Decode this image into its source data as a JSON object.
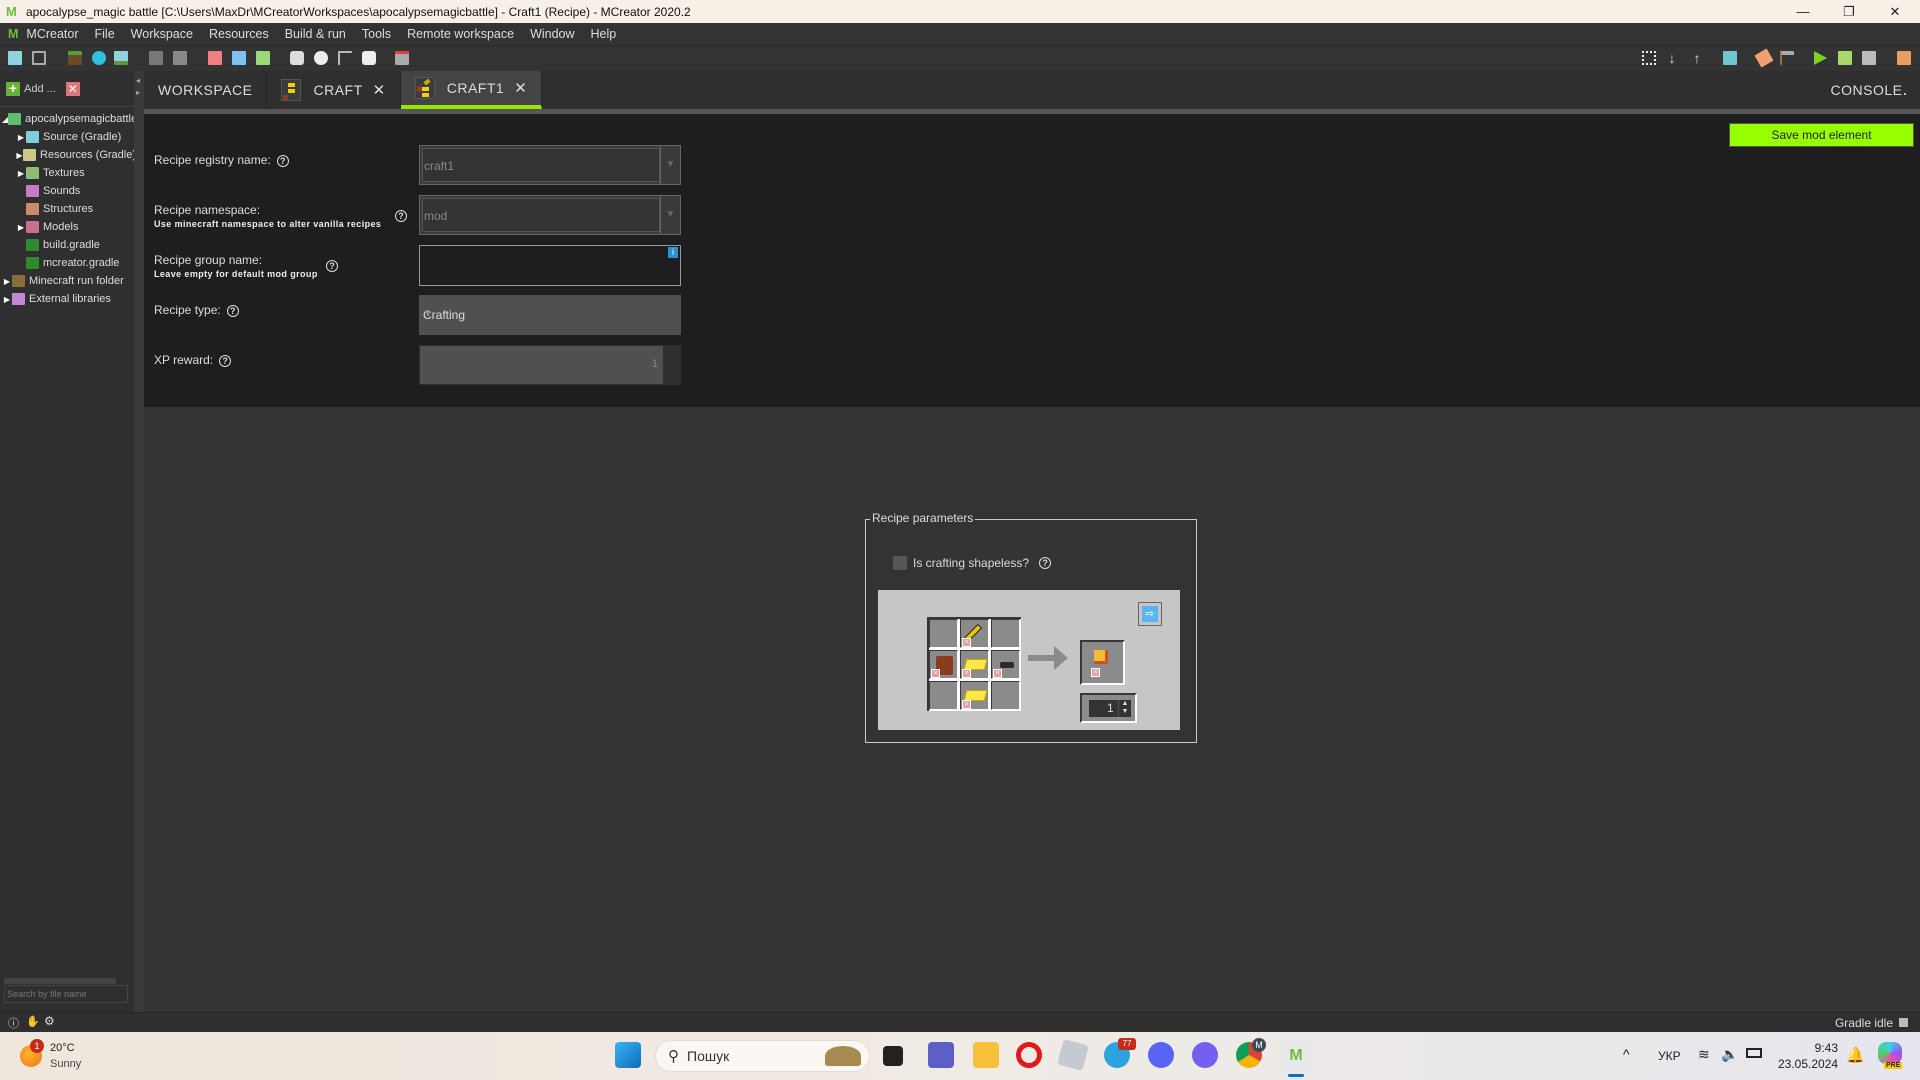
{
  "window": {
    "title": "apocalypse_magic battle [C:\\Users\\MaxDr\\MCreatorWorkspaces\\apocalypsemagicbattle] - Craft1 (Recipe) - MCreator 2020.2",
    "controls": {
      "minimize": "—",
      "restore": "❐",
      "close": "✕"
    }
  },
  "menu": [
    "MCreator",
    "File",
    "Workspace",
    "Resources",
    "Build & run",
    "Tools",
    "Remote workspace",
    "Window",
    "Help"
  ],
  "toolbar": {
    "left_icons": [
      "new-image-icon",
      "new-animation-icon",
      "import-block-texture-icon",
      "import-item-texture-icon",
      "import-painting-icon",
      "import-sound-icon",
      "import-structure-icon",
      "model-red-icon",
      "model-blue-icon",
      "model-green-icon",
      "create-armor-icon",
      "create-entity-icon",
      "create-tool-icon",
      "create-mob-icon",
      "variables-icon"
    ],
    "right_icons": [
      "git-branch-icon",
      "pull-icon",
      "push-icon",
      "workspace-settings-icon",
      "regenerate-code-icon",
      "build-icon",
      "run-client-icon",
      "run-server-icon",
      "stop-icon",
      "export-icon"
    ]
  },
  "sidebar": {
    "add_label": "Add ...",
    "tree": [
      {
        "label": "apocalypsemagicbattle",
        "icon": "workspace-icon",
        "expanded": true,
        "level": 0,
        "color": "#5fbf6e"
      },
      {
        "label": "Source (Gradle)",
        "icon": "folder-source-icon",
        "expanded": false,
        "level": 1,
        "color": "#7ccfd6"
      },
      {
        "label": "Resources (Gradle)",
        "icon": "folder-resources-icon",
        "expanded": false,
        "level": 1,
        "color": "#c9c98a"
      },
      {
        "label": "Textures",
        "icon": "folder-textures-icon",
        "expanded": false,
        "level": 1,
        "color": "#8fbf6e"
      },
      {
        "label": "Sounds",
        "icon": "folder-sounds-icon",
        "expanded": null,
        "level": 1,
        "color": "#c77bc0"
      },
      {
        "label": "Structures",
        "icon": "folder-structures-icon",
        "expanded": null,
        "level": 1,
        "color": "#c98a6e"
      },
      {
        "label": "Models",
        "icon": "folder-models-icon",
        "expanded": false,
        "level": 1,
        "color": "#c77090"
      },
      {
        "label": "build.gradle",
        "icon": "gradle-file-icon",
        "expanded": null,
        "level": 1,
        "color": "#2d8a2d"
      },
      {
        "label": "mcreator.gradle",
        "icon": "gradle-file-icon",
        "expanded": null,
        "level": 1,
        "color": "#2d8a2d"
      },
      {
        "label": "Minecraft run folder",
        "icon": "folder-minecraft-icon",
        "expanded": false,
        "level": 0,
        "color": "#8a6b3a"
      },
      {
        "label": "External libraries",
        "icon": "folder-libraries-icon",
        "expanded": false,
        "level": 0,
        "color": "#c28ad6"
      }
    ],
    "search_placeholder": "Search by file name"
  },
  "tabs": [
    {
      "label": "WORKSPACE",
      "has_icon": false,
      "closable": false,
      "active": false
    },
    {
      "label": "CRAFT",
      "has_icon": true,
      "closable": true,
      "active": false
    },
    {
      "label": "CRAFT1",
      "has_icon": true,
      "closable": true,
      "active": true
    }
  ],
  "console_label": "CONSOLE",
  "save_button": "Save mod element",
  "form": {
    "registry_name": {
      "label": "Recipe registry name:",
      "value": "craft1"
    },
    "namespace": {
      "label": "Recipe namespace:",
      "hint": "Use minecraft namespace to alter vanilla recipes",
      "value": "mod"
    },
    "group_name": {
      "label": "Recipe group name:",
      "hint": "Leave empty for default mod group",
      "value": ""
    },
    "recipe_type": {
      "label": "Recipe type:",
      "value": "Crafting"
    },
    "xp_reward": {
      "label": "XP reward:",
      "value": "1"
    },
    "help_glyph": "?"
  },
  "recipe_params": {
    "title": "Recipe parameters",
    "shapeless_label": "Is crafting shapeless?",
    "shapeless_checked": false,
    "grid": [
      [
        null,
        "golden-sword",
        null
      ],
      [
        "leather-tunic",
        "gold-ingot",
        "coal-piece"
      ],
      [
        null,
        "gold-ingot",
        null
      ]
    ],
    "result_item": "orange-book",
    "result_count": "1",
    "accent_slot_color": "#8b8b8b"
  },
  "status": {
    "gradle": "Gradle idle"
  },
  "taskbar": {
    "weather_temp": "20°C",
    "weather_desc": "Sunny",
    "weather_badge": "1",
    "search_placeholder": "Пошук",
    "telegram_badge": "77",
    "chrome_badge": "M",
    "language": "УКР",
    "time": "9:43",
    "date": "23.05.2024",
    "copilot_badge": "PRE"
  },
  "colors": {
    "accent": "#98ff00",
    "tab_active_underline": "#98e600",
    "info_badge": "#2b8fd0"
  }
}
